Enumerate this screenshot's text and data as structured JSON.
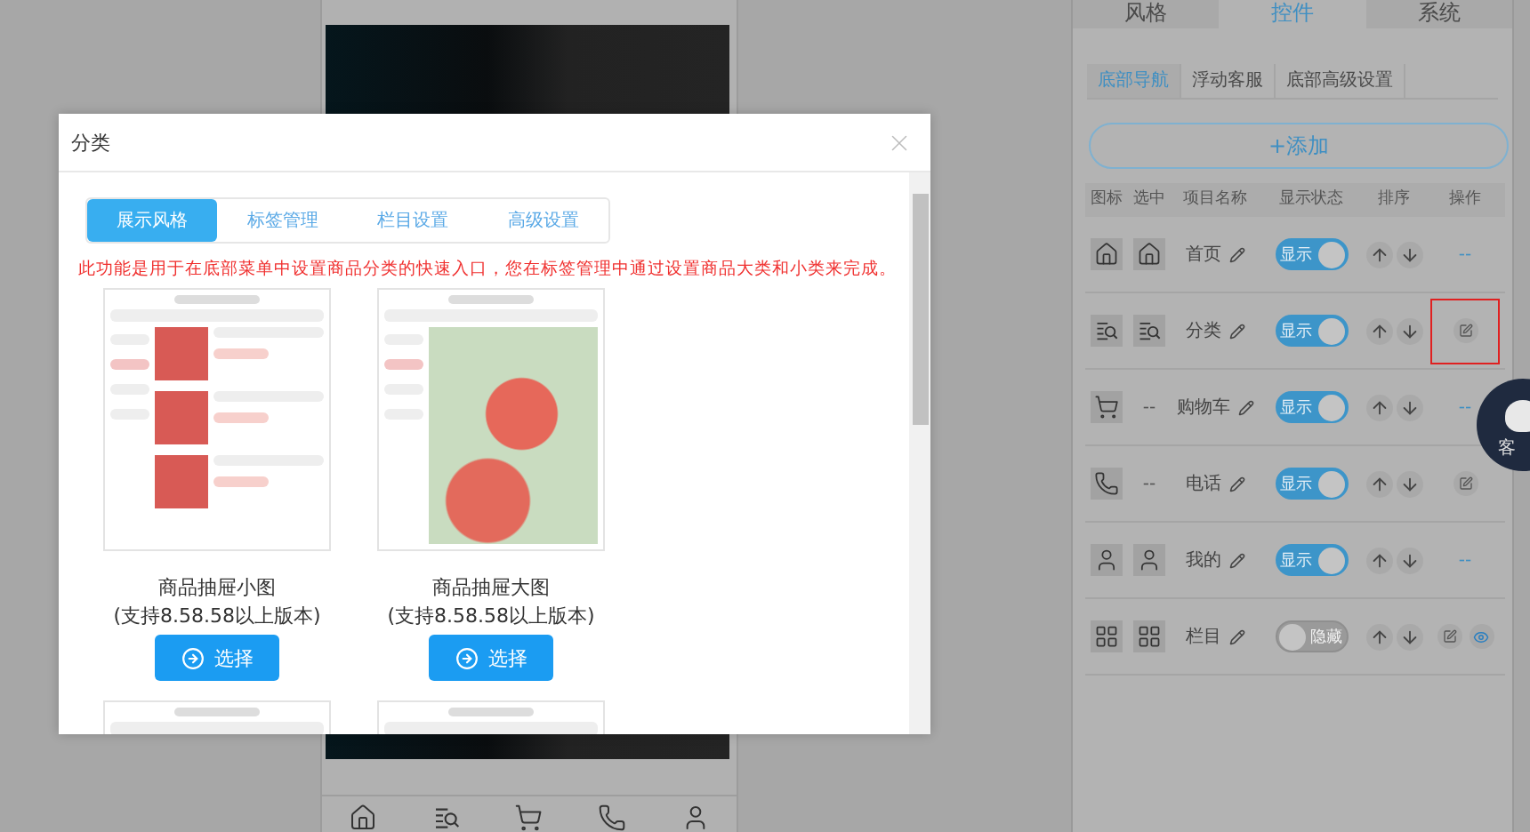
{
  "side_panel": {
    "tabs": [
      {
        "label": "风格",
        "selected": false
      },
      {
        "label": "控件",
        "selected": true
      },
      {
        "label": "系统",
        "selected": false
      }
    ],
    "subtabs": [
      {
        "label": "底部导航",
        "selected": true
      },
      {
        "label": "浮动客服",
        "selected": false
      },
      {
        "label": "底部高级设置",
        "selected": false
      }
    ],
    "add_button": "+添加",
    "columns": [
      "图标",
      "选中",
      "项目名称",
      "显示状态",
      "排序",
      "操作"
    ],
    "rows": [
      {
        "kind": "home",
        "selected_icon": {
          "kind": "icon"
        },
        "name": "首页",
        "toggle": {
          "on": true,
          "label": "显示"
        },
        "actions": [
          {
            "kind": "text",
            "label": "--"
          }
        ],
        "highlighted": false
      },
      {
        "kind": "category",
        "selected_icon": {
          "kind": "icon"
        },
        "name": "分类",
        "toggle": {
          "on": true,
          "label": "显示"
        },
        "actions": [
          {
            "kind": "edit"
          }
        ],
        "highlighted": true
      },
      {
        "kind": "cart",
        "selected_icon": {
          "kind": "text",
          "label": "--"
        },
        "name": "购物车",
        "toggle": {
          "on": true,
          "label": "显示"
        },
        "actions": [
          {
            "kind": "text",
            "label": "--"
          }
        ],
        "highlighted": false
      },
      {
        "kind": "phone",
        "selected_icon": {
          "kind": "text",
          "label": "--"
        },
        "name": "电话",
        "toggle": {
          "on": true,
          "label": "显示"
        },
        "actions": [
          {
            "kind": "edit"
          }
        ],
        "highlighted": false
      },
      {
        "kind": "user",
        "selected_icon": {
          "kind": "icon"
        },
        "name": "我的",
        "toggle": {
          "on": true,
          "label": "显示"
        },
        "actions": [
          {
            "kind": "text",
            "label": "--"
          }
        ],
        "highlighted": false
      },
      {
        "kind": "grid",
        "selected_icon": {
          "kind": "icon"
        },
        "name": "栏目",
        "toggle": {
          "on": false,
          "label": "隐藏"
        },
        "actions": [
          {
            "kind": "edit"
          },
          {
            "kind": "eye"
          }
        ],
        "highlighted": false
      }
    ]
  },
  "floating_service": {
    "label": "客"
  },
  "phone_preview": {
    "nav_icons": [
      {
        "kind": "home"
      },
      {
        "kind": "category"
      },
      {
        "kind": "cart"
      },
      {
        "kind": "phone"
      },
      {
        "kind": "user"
      }
    ]
  },
  "modal": {
    "title": "分类",
    "tabs": [
      {
        "label": "展示风格",
        "selected": true
      },
      {
        "label": "标签管理",
        "selected": false
      },
      {
        "label": "栏目设置",
        "selected": false
      },
      {
        "label": "高级设置",
        "selected": false
      }
    ],
    "notice": "此功能是用于在底部菜单中设置商品分类的快速入口，您在标签管理中通过设置商品大类和小类来完成。",
    "styles": [
      {
        "kind": "small",
        "name": "商品抽屉小图",
        "note": "(支持8.58.58以上版本)",
        "button": "选择"
      },
      {
        "kind": "large",
        "name": "商品抽屉大图",
        "note": "(支持8.58.58以上版本)",
        "button": "选择"
      },
      {
        "kind": "all"
      },
      {
        "kind": "all"
      }
    ]
  }
}
